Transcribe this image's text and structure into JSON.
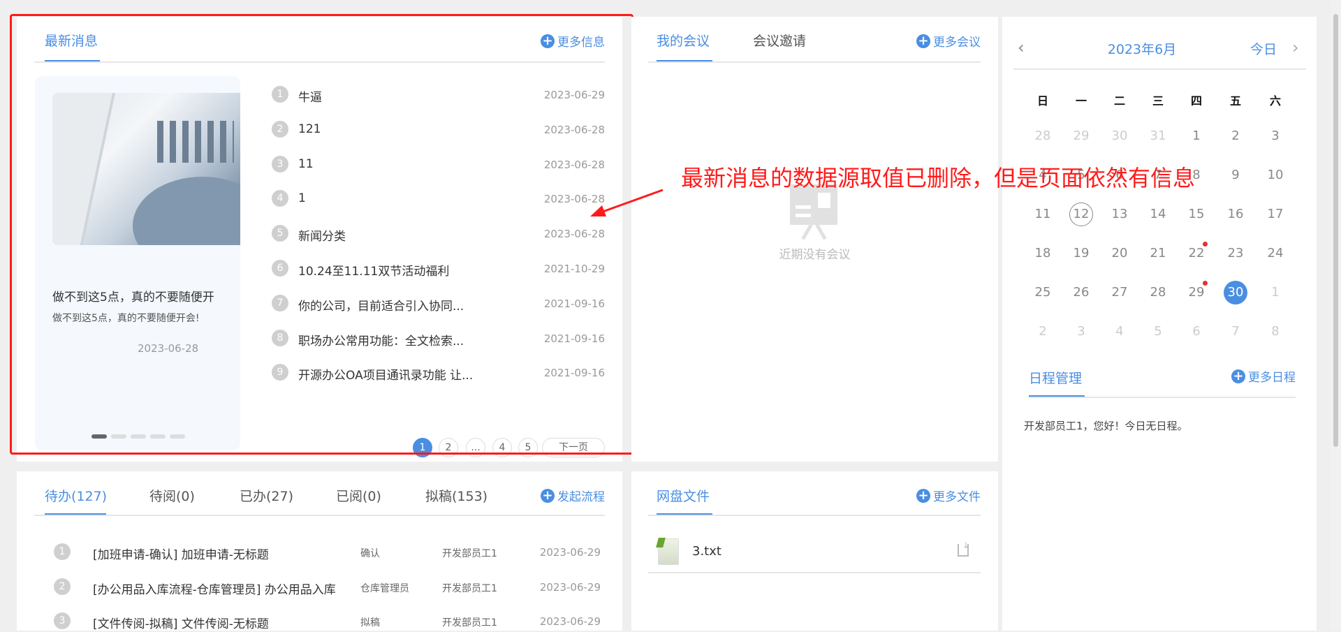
{
  "news": {
    "tab": "最新消息",
    "more": "更多信息",
    "carousel": {
      "title": "做不到这5点，真的不要随便开",
      "summary": "做不到这5点，真的不要随便开会!",
      "date": "2023-06-28",
      "slides": 5,
      "active_slide": 1
    },
    "items": [
      {
        "n": "1",
        "title": "牛逼",
        "date": "2023-06-29"
      },
      {
        "n": "2",
        "title": "121",
        "date": "2023-06-28"
      },
      {
        "n": "3",
        "title": "11",
        "date": "2023-06-28"
      },
      {
        "n": "4",
        "title": "1",
        "date": "2023-06-28"
      },
      {
        "n": "5",
        "title": "新闻分类",
        "date": "2023-06-28"
      },
      {
        "n": "6",
        "title": "10.24至11.11双节活动福利",
        "date": "2021-10-29"
      },
      {
        "n": "7",
        "title": "你的公司，目前适合引入协同...",
        "date": "2021-09-16"
      },
      {
        "n": "8",
        "title": "职场办公常用功能：全文检索...",
        "date": "2021-09-16"
      },
      {
        "n": "9",
        "title": "开源办公OA项目通讯录功能 让...",
        "date": "2021-09-16"
      }
    ],
    "pagination": {
      "pages": [
        "1",
        "2",
        "...",
        "4",
        "5"
      ],
      "current": "1",
      "next": "下一页"
    }
  },
  "meeting": {
    "tabs": [
      "我的会议",
      "会议邀请"
    ],
    "more": "更多会议",
    "empty": "近期没有会议"
  },
  "annotation": "最新消息的数据源取值已删除，但是页面依然有信息",
  "calendar": {
    "title": "2023年6月",
    "today_btn": "今日",
    "weekdays": [
      "日",
      "一",
      "二",
      "三",
      "四",
      "五",
      "六"
    ],
    "weeks": [
      [
        "28",
        "29",
        "30",
        "31",
        "1",
        "2",
        "3"
      ],
      [
        "4",
        "5",
        "6",
        "7",
        "8",
        "9",
        "10"
      ],
      [
        "11",
        "12",
        "13",
        "14",
        "15",
        "16",
        "17"
      ],
      [
        "18",
        "19",
        "20",
        "21",
        "22",
        "23",
        "24"
      ],
      [
        "25",
        "26",
        "27",
        "28",
        "29",
        "30",
        "1"
      ],
      [
        "2",
        "3",
        "4",
        "5",
        "6",
        "7",
        "8"
      ]
    ],
    "today": "12",
    "selected": "30",
    "event_days": [
      "22",
      "29"
    ]
  },
  "schedule": {
    "tab": "日程管理",
    "more": "更多日程",
    "message": "开发部员工1，您好！今日无日程。"
  },
  "workflow": {
    "tabs": [
      "待办(127)",
      "待阅(0)",
      "已办(27)",
      "已阅(0)",
      "拟稿(153)"
    ],
    "start": "发起流程",
    "rows": [
      {
        "n": "1",
        "title": "[加班申请-确认] 加班申请-无标题",
        "node": "确认",
        "user": "开发部员工1",
        "date": "2023-06-29"
      },
      {
        "n": "2",
        "title": "[办公用品入库流程-仓库管理员] 办公用品入库",
        "node": "仓库管理员",
        "user": "开发部员工1",
        "date": "2023-06-29"
      },
      {
        "n": "3",
        "title": "[文件传阅-拟稿] 文件传阅-无标题",
        "node": "拟稿",
        "user": "开发部员工1",
        "date": "2023-06-29"
      }
    ]
  },
  "files": {
    "tab": "网盘文件",
    "more": "更多文件",
    "items": [
      {
        "name": "3.txt"
      }
    ]
  },
  "colors": {
    "accent": "#4a8ee2",
    "annotation": "#ff1a1a",
    "event_dot": "#e0342e"
  }
}
